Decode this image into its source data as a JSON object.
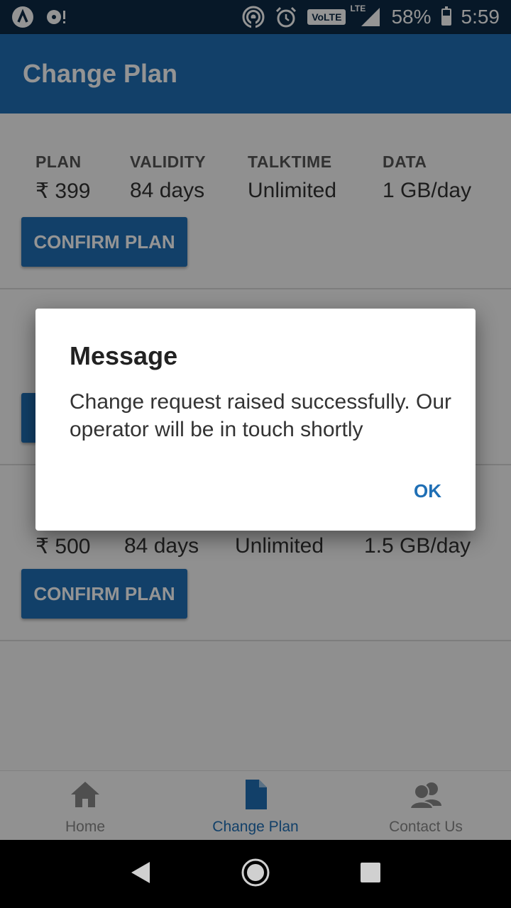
{
  "status_bar": {
    "battery": "58%",
    "time": "5:59",
    "network": "LTE",
    "volte": "VoLTE",
    "battery_level": 0.58,
    "icons": [
      "app-icon",
      "media-icon",
      "hotspot-icon",
      "alarm-icon",
      "volte-icon",
      "lte-signal-icon",
      "battery-icon"
    ]
  },
  "app_bar": {
    "title": "Change Plan"
  },
  "plan_headers": {
    "plan": "PLAN",
    "validity": "VALIDITY",
    "talktime": "TALKTIME",
    "data": "DATA"
  },
  "plans": [
    {
      "price": "₹ 399",
      "validity": "84 days",
      "talktime": "Unlimited",
      "data": "1 GB/day",
      "button": "CONFIRM PLAN"
    },
    {
      "price": "₹ 500",
      "validity": "84 days",
      "talktime": "Unlimited",
      "data": "1.5 GB/day",
      "button": "CONFIRM PLAN"
    }
  ],
  "dialog": {
    "title": "Message",
    "message": "Change request raised successfully. Our operator will be in touch shortly",
    "ok": "OK"
  },
  "bottom_nav": {
    "items": [
      {
        "label": "Home",
        "icon": "home-icon"
      },
      {
        "label": "Change Plan",
        "icon": "document-icon"
      },
      {
        "label": "Contact Us",
        "icon": "contacts-icon"
      }
    ],
    "active_color": "#1f6fb5"
  },
  "colors": {
    "primary": "#1f6fb5",
    "status_bar": "#0d2a45"
  }
}
